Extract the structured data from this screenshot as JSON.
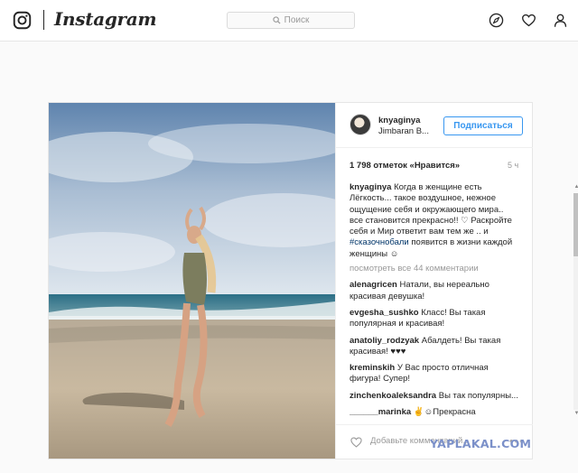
{
  "nav": {
    "wordmark": "Instagram",
    "search_placeholder": "Поиск"
  },
  "post": {
    "username": "knyaginya",
    "location": "Jimbaran B...",
    "follow_label": "Подписаться",
    "likes": "1 798 отметок «Нравится»",
    "time": "5 ч",
    "caption": {
      "user": "knyaginya",
      "text_before_tag": "Когда в женщине есть Лёгкость... такое воздушное, нежное ощущение себя и окружающего мира.. все становится прекрасно!! ♡ Раскройте себя и Мир ответит вам тем же .. и",
      "tag": "#сказочнобали",
      "text_after_tag": "появится в жизни каждой женщины ☺"
    },
    "view_all": "посмотреть все 44 комментарии",
    "comments": [
      {
        "user": "alenagricen",
        "text": "Натали, вы нереально красивая девушка!"
      },
      {
        "user": "evgesha_sushko",
        "text": "Класс! Вы такая популярная и красивая!"
      },
      {
        "user": "anatoliy_rodzyak",
        "text": "Абалдеть! Вы такая красивая! ♥♥♥"
      },
      {
        "user": "kreminskih",
        "text": "У Вас просто отличная фигура! Супер!"
      },
      {
        "user": "zinchenkoaleksandra",
        "text": "Вы так популярны..."
      },
      {
        "user": "______marinka",
        "text": "✌☺Прекрасна"
      }
    ],
    "add_comment_placeholder": "Добавьте комментарий...",
    "more_glyph": "•••"
  },
  "watermark": "YAPLAKAL.COM",
  "colors": {
    "accent": "#3897f0",
    "border": "#e6e6e6",
    "background": "#fafafa"
  },
  "icons": [
    "instagram-logo-icon",
    "search-icon",
    "compass-icon",
    "heart-icon",
    "profile-icon",
    "like-heart-icon"
  ]
}
